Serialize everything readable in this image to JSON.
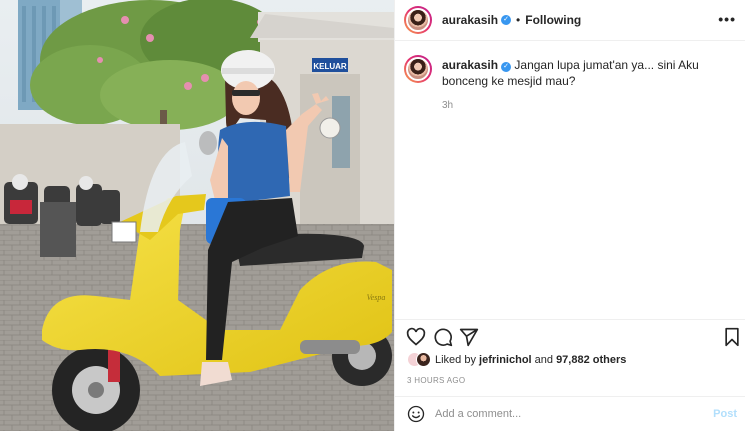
{
  "post": {
    "header": {
      "username": "aurakasih",
      "separator": "•",
      "follow_status": "Following",
      "more_label": "•••"
    },
    "caption": {
      "username": "aurakasih",
      "text": "Jangan lupa jumat'an ya... sini Aku bonceng ke mesjid mau?",
      "time_ago": "3h"
    },
    "media": {
      "sign_text": "KELUAR",
      "plate_text": "",
      "scooter_brand": "Vespa"
    },
    "likes": {
      "prefix": "Liked by ",
      "user": "jefrinichol",
      "middle": " and ",
      "count": "97,882 others"
    },
    "date": "3 HOURS AGO",
    "comment": {
      "placeholder": "Add a comment...",
      "post_label": "Post"
    },
    "colors": {
      "accent_blue": "#3897f0",
      "post_disabled": "#b2dffc",
      "scooter_yellow": "#f1d629"
    },
    "icons": [
      "heart-icon",
      "comment-icon",
      "share-icon",
      "bookmark-icon",
      "emoji-icon",
      "verified-icon",
      "more-options-icon"
    ]
  }
}
